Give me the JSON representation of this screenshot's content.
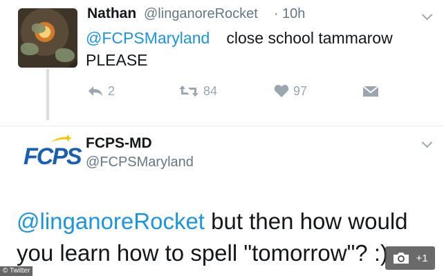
{
  "tweet1": {
    "name": "Nathan",
    "handle": "@linganoreRocket",
    "separator": "·",
    "time": "10h",
    "mention": "@FCPSMaryland",
    "text_line1": " close school tammarow",
    "text_line2": "PLEASE",
    "replies": "2",
    "retweets": "84",
    "likes": "97"
  },
  "tweet2": {
    "name": "FCPS-MD",
    "handle": "@FCPSMaryland",
    "logo_text": "FCPS",
    "mention": "@linganoreRocket",
    "text": " but then how would you learn how to spell \"tomorrow\"? :)"
  },
  "credit": "© Twitter",
  "photo_badge": {
    "count": "+1",
    "icon": "camera-icon"
  },
  "colors": {
    "link": "#1b95e0",
    "muted": "#657786",
    "icon": "#9aa7b2",
    "fcps_blue": "#1a5fb4",
    "fcps_star": "#f2c500"
  }
}
